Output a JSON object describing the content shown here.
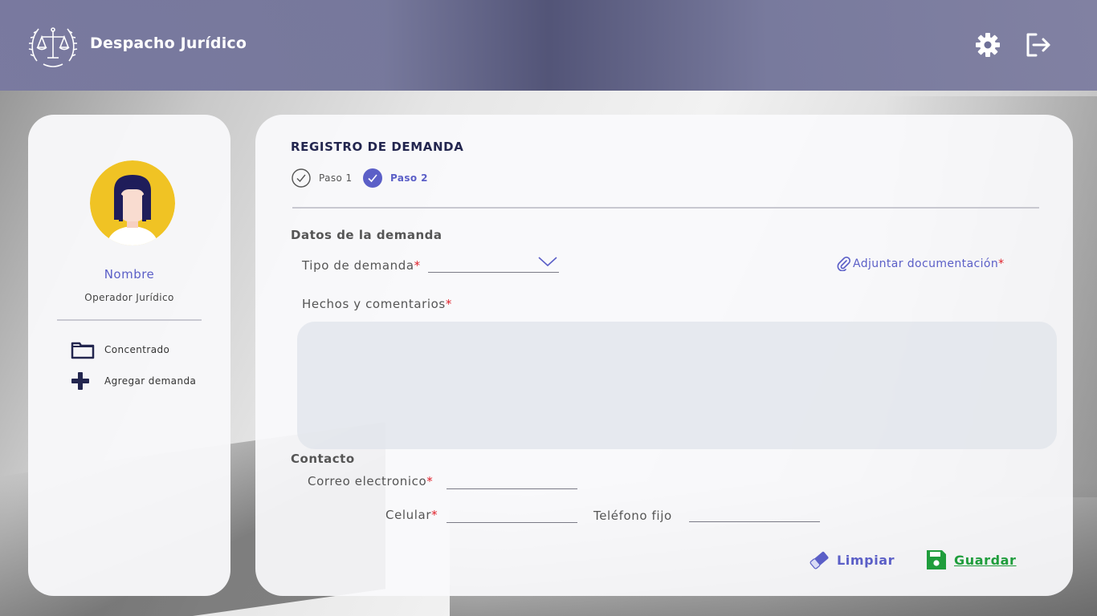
{
  "header": {
    "brand": "Despacho Jurídico",
    "icons": {
      "logo": "scales-of-justice-laurel-icon",
      "settings": "gear-icon",
      "logout": "logout-icon"
    }
  },
  "sidebar": {
    "user_name": "Nombre",
    "user_role": "Operador Jurídico",
    "items": [
      {
        "label": "Concentrado",
        "icon": "folder-icon"
      },
      {
        "label": "Agregar demanda",
        "icon": "plus-icon"
      }
    ]
  },
  "form": {
    "title": "REGISTRO DE DEMANDA",
    "steps": [
      {
        "label": "Paso 1",
        "state": "done"
      },
      {
        "label": "Paso 2",
        "state": "active"
      }
    ],
    "section_datos": "Datos de la demanda",
    "tipo_label": "Tipo de demanda",
    "tipo_value": "",
    "attach_label": "Adjuntar documentación",
    "hechos_label": "Hechos y comentarios",
    "hechos_value": "",
    "section_contacto": "Contacto",
    "correo_label": "Correo electronico",
    "celular_label": "Celular",
    "telefono_label": "Teléfono fijo",
    "required_mark": "*",
    "limpiar_label": "Limpiar",
    "guardar_label": "Guardar"
  },
  "colors": {
    "accent": "#5b5fc7",
    "navy": "#23264f",
    "required": "#e0202a",
    "save_green": "#1f9d3c",
    "avatar_bg": "#f0c324"
  }
}
